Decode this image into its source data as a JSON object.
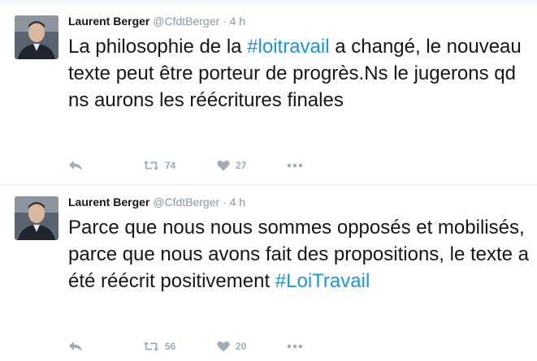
{
  "tweets": [
    {
      "author": "Laurent Berger",
      "handle": "@CfdtBerger",
      "separator": "·",
      "time": "4 h",
      "text_before": "La philosophie de la ",
      "hashtag": "#loitravail",
      "text_after": " a changé, le nouveau texte peut être porteur de progrès.Ns le jugerons qd ns aurons les réécritures finales",
      "retweets": "74",
      "likes": "27"
    },
    {
      "author": "Laurent Berger",
      "handle": "@CfdtBerger",
      "separator": "·",
      "time": "4 h",
      "text_before": "Parce que nous nous sommes opposés et mobilisés, parce que nous avons fait des propositions, le texte a été réécrit positivement ",
      "hashtag": "#LoiTravail",
      "text_after": "",
      "retweets": "56",
      "likes": "20"
    }
  ],
  "colors": {
    "hashtag": "#1b95e0",
    "action": "#a0acb6",
    "muted": "#8899a6"
  },
  "icons": [
    "reply-icon",
    "retweet-icon",
    "heart-icon",
    "more-icon"
  ]
}
